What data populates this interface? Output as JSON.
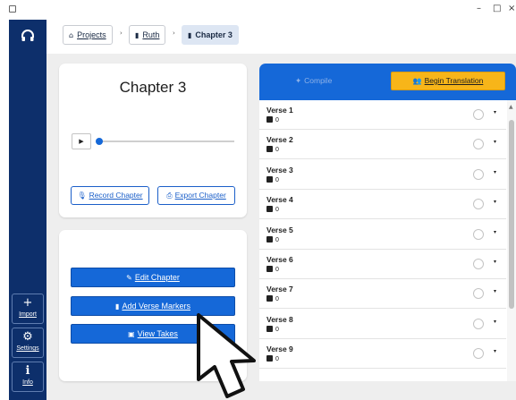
{
  "window": {
    "minimize": "–",
    "maximize": "□",
    "close": "×"
  },
  "nav": {
    "logo_icon": "headphones-icon",
    "buttons": [
      {
        "label": "Import",
        "icon": "plus-icon",
        "glyph": "+"
      },
      {
        "label": "Settings",
        "icon": "gear-icon",
        "glyph": "⚙"
      },
      {
        "label": "Info",
        "icon": "info-icon",
        "glyph": "ℹ"
      }
    ]
  },
  "breadcrumb": {
    "items": [
      {
        "label": "Projects",
        "icon": "home-icon",
        "glyph": "⌂"
      },
      {
        "label": "Ruth",
        "icon": "book-icon",
        "glyph": "▮"
      },
      {
        "label": "Chapter 3",
        "icon": "chapter-icon",
        "glyph": "▮"
      }
    ],
    "separator": "›"
  },
  "chapter": {
    "title": "Chapter 3",
    "play_glyph": "▶",
    "playback_fraction": 0.0,
    "record_label": "Record Chapter",
    "record_glyph": "🎙",
    "export_label": "Export Chapter",
    "export_glyph": "⎙"
  },
  "actions": {
    "edit_label": "Edit Chapter",
    "edit_glyph": "✎",
    "markers_label": "Add Verse Markers",
    "markers_glyph": "▮",
    "takes_label": "View Takes",
    "takes_glyph": "▣"
  },
  "verses_panel": {
    "compile_label": "Compile",
    "compile_glyph": "✦",
    "begin_label": "Begin Translation",
    "begin_glyph": "👥",
    "caret": "▾",
    "verses": [
      {
        "name": "Verse 1",
        "count": "0"
      },
      {
        "name": "Verse 2",
        "count": "0"
      },
      {
        "name": "Verse 3",
        "count": "0"
      },
      {
        "name": "Verse 4",
        "count": "0"
      },
      {
        "name": "Verse 5",
        "count": "0"
      },
      {
        "name": "Verse 6",
        "count": "0"
      },
      {
        "name": "Verse 7",
        "count": "0"
      },
      {
        "name": "Verse 8",
        "count": "0"
      },
      {
        "name": "Verse 9",
        "count": "0"
      }
    ]
  },
  "colors": {
    "nav_bg": "#0d2f6b",
    "accent_blue": "#1568d8",
    "accent_yellow": "#f7b519",
    "content_bg": "#eeeeee"
  }
}
